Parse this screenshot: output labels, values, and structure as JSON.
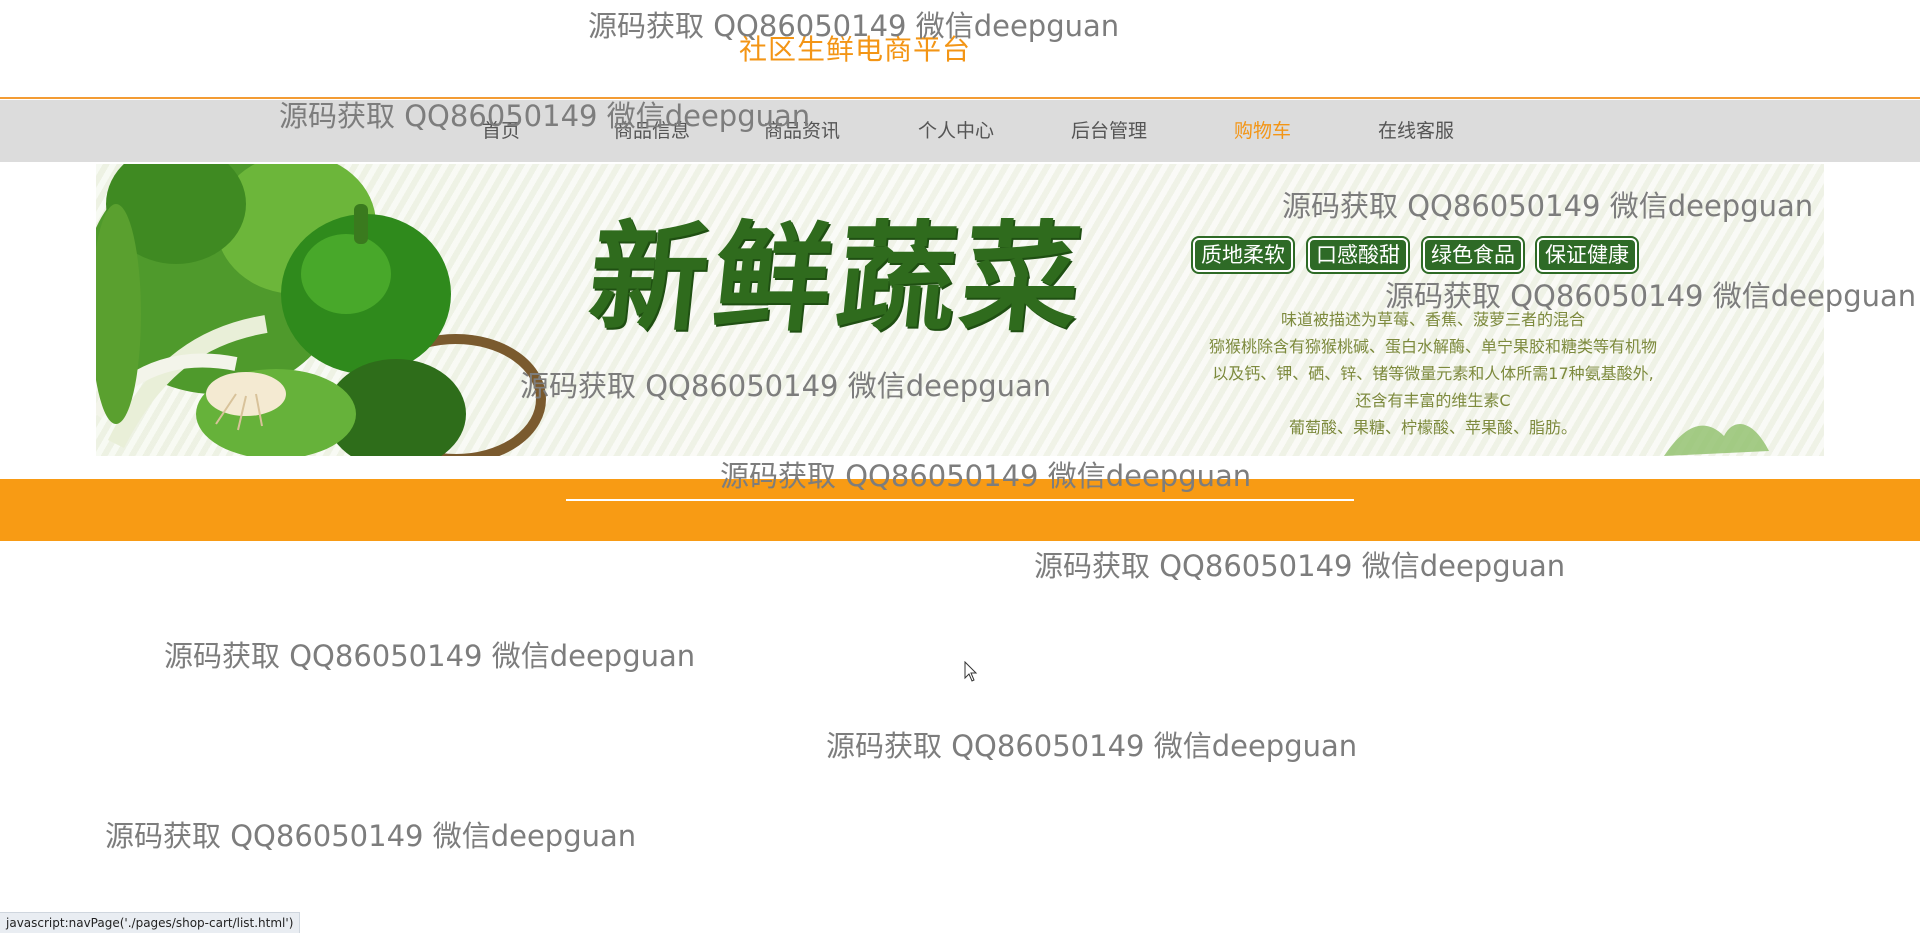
{
  "header": {
    "site_title": "社区生鲜电商平台"
  },
  "nav": {
    "items": [
      {
        "label": "首页"
      },
      {
        "label": "商品信息"
      },
      {
        "label": "商品资讯"
      },
      {
        "label": "个人中心"
      },
      {
        "label": "后台管理"
      },
      {
        "label": "购物车",
        "active": true
      },
      {
        "label": "在线客服"
      }
    ]
  },
  "banner": {
    "title": "新鲜蔬菜",
    "tags": [
      "质地柔软",
      "口感酸甜",
      "绿色食品",
      "保证健康"
    ],
    "description": [
      "味道被描述为草莓、香蕉、菠萝三者的混合",
      "猕猴桃除含有猕猴桃碱、蛋白水解酶、单宁果胶和糖类等有机物",
      "以及钙、钾、硒、锌、锗等微量元素和人体所需17种氨基酸外,",
      "还含有丰富的维生素C",
      "葡萄酸、果糖、柠檬酸、苹果酸、脂肪。"
    ]
  },
  "watermark": {
    "text": "源码获取 QQ86050149 微信deepguan"
  },
  "status_bar": {
    "url": "javascript:navPage('./pages/shop-cart/list.html')"
  },
  "colors": {
    "accent": "#f39515",
    "band": "#f89b14",
    "nav_bg": "#dcdcdc",
    "banner_green": "#2e6a26"
  }
}
